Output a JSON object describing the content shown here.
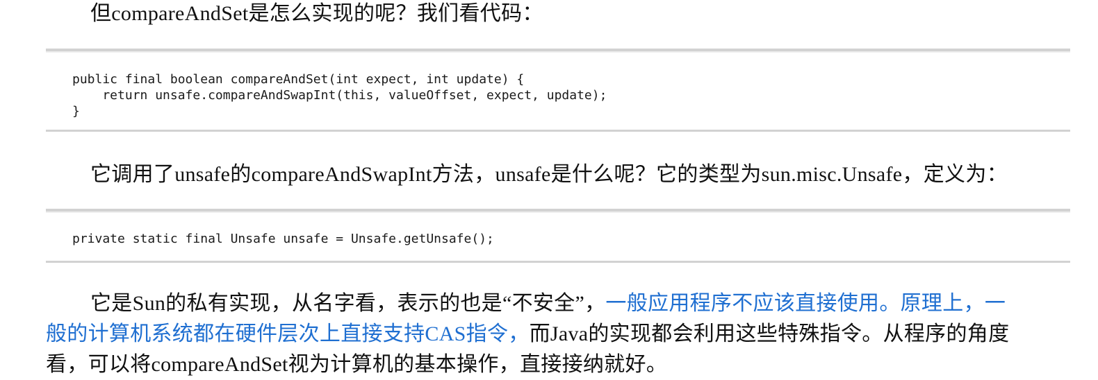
{
  "paragraph_1": {
    "text": "但compareAndSet是怎么实现的呢？我们看代码："
  },
  "code_block_1": {
    "lines": [
      "public final boolean compareAndSet(int expect, int update) {",
      "    return unsafe.compareAndSwapInt(this, valueOffset, expect, update);",
      "}"
    ]
  },
  "paragraph_2": {
    "text": "它调用了unsafe的compareAndSwapInt方法，unsafe是什么呢？它的类型为sun.misc.Unsafe，定义为："
  },
  "code_block_2": {
    "lines": [
      "private static final Unsafe unsafe = Unsafe.getUnsafe();"
    ]
  },
  "paragraph_3": {
    "line_1_plain": "它是Sun的私有实现，从名字看，表示的也是“不安全”，",
    "line_1_highlight": "一般应用程序不应该直接使用。原理上，一",
    "line_2_highlight": "般的计算机系统都在硬件层次上直接支持CAS指令，",
    "line_2_plain": "而Java的实现都会利用这些特殊指令。从程序的角度",
    "line_3_plain": "看，可以将compareAndSet视为计算机的基本操作，直接接纳就好。",
    "highlight_color": "#1f6fd1"
  }
}
